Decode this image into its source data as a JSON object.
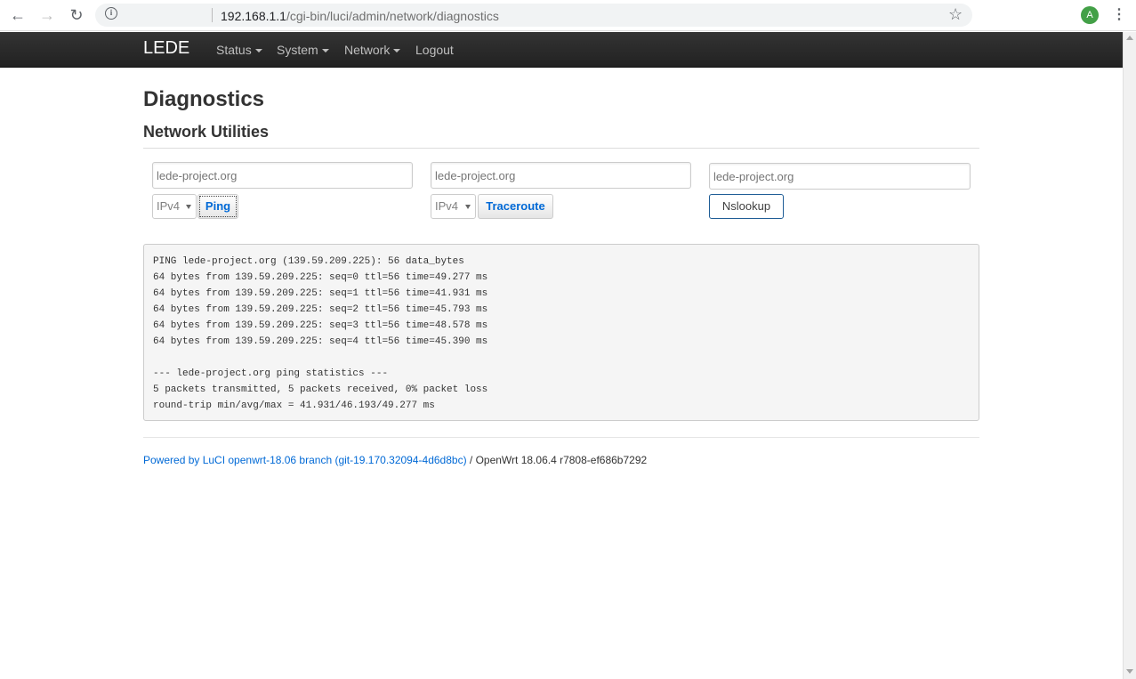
{
  "browser": {
    "url_host": "192.168.1.1",
    "url_path": "/cgi-bin/luci/admin/network/diagnostics",
    "avatar_letter": "A"
  },
  "navbar": {
    "brand": "LEDE",
    "items": [
      {
        "label": "Status"
      },
      {
        "label": "System"
      },
      {
        "label": "Network"
      },
      {
        "label": "Logout"
      }
    ]
  },
  "page": {
    "title": "Diagnostics",
    "section_title": "Network Utilities"
  },
  "tools": {
    "ping": {
      "host_placeholder": "lede-project.org",
      "protocol": "IPv4",
      "button_label": "Ping"
    },
    "traceroute": {
      "host_placeholder": "lede-project.org",
      "protocol": "IPv4",
      "button_label": "Traceroute"
    },
    "nslookup": {
      "host_placeholder": "lede-project.org",
      "button_label": "Nslookup"
    }
  },
  "output": {
    "text": "PING lede-project.org (139.59.209.225): 56 data_bytes\n64 bytes from 139.59.209.225: seq=0 ttl=56 time=49.277 ms\n64 bytes from 139.59.209.225: seq=1 ttl=56 time=41.931 ms\n64 bytes from 139.59.209.225: seq=2 ttl=56 time=45.793 ms\n64 bytes from 139.59.209.225: seq=3 ttl=56 time=48.578 ms\n64 bytes from 139.59.209.225: seq=4 ttl=56 time=45.390 ms\n\n--- lede-project.org ping statistics ---\n5 packets transmitted, 5 packets received, 0% packet loss\nround-trip min/avg/max = 41.931/46.193/49.277 ms"
  },
  "footer": {
    "link_text": "Powered by LuCI openwrt-18.06 branch (git-19.170.32094-4d6d8bc)",
    "version_text": " / OpenWrt 18.06.4 r7808-ef686b7292"
  },
  "colors": {
    "navbar_bg": "#222222",
    "link": "#0069d6",
    "output_bg": "#f5f5f5"
  }
}
